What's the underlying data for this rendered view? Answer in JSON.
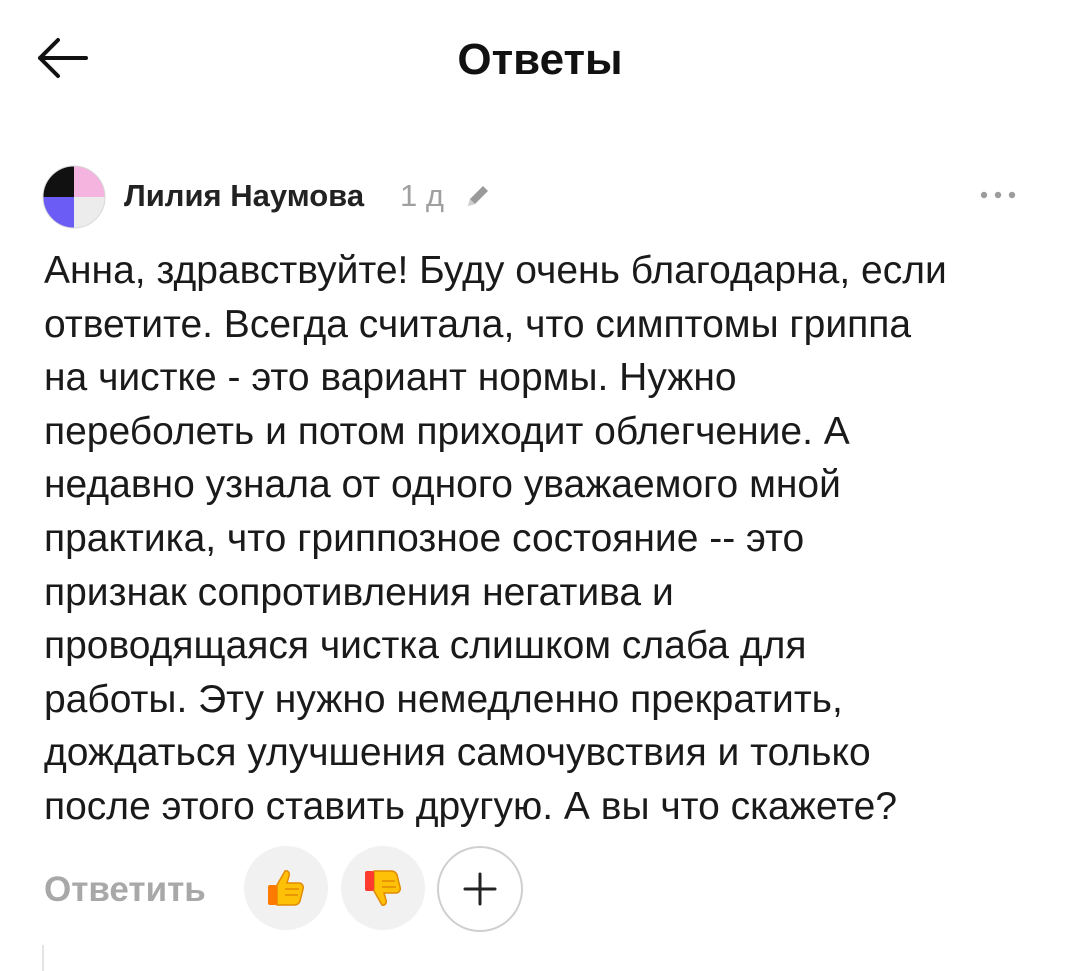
{
  "header": {
    "title": "Ответы",
    "back_icon": "arrow-left-icon"
  },
  "comment": {
    "author": "Лилия Наумова",
    "time": "1 д",
    "edited_icon": "pencil-icon",
    "more_icon": "ellipsis-icon",
    "avatar_colors": {
      "top_left": "#111111",
      "top_right": "#f5b3e0",
      "bottom_left": "#6b5cf6",
      "bottom_right": "#ececec"
    },
    "text": "Анна, здравствуйте! Буду очень благодарна, если\nответите. Всегда считала, что симптомы гриппа\nна чистке - это вариант нормы. Нужно\nпереболеть и потом приходит облегчение. А\nнедавно узнала от одного уважаемого мной\nпрактика, что гриппозное состояние -- это\nпризнак сопротивления негатива и\nпроводящаяся чистка слишком слаба для\nработы. Эту нужно немедленно прекратить,\nдождаться улучшения самочувствия и только\nпосле этого ставить другую. А вы что скажете?"
  },
  "actions": {
    "reply_label": "Ответить",
    "like_emoji": "👍",
    "dislike_emoji": "👎",
    "add_reaction_icon": "plus-icon"
  }
}
